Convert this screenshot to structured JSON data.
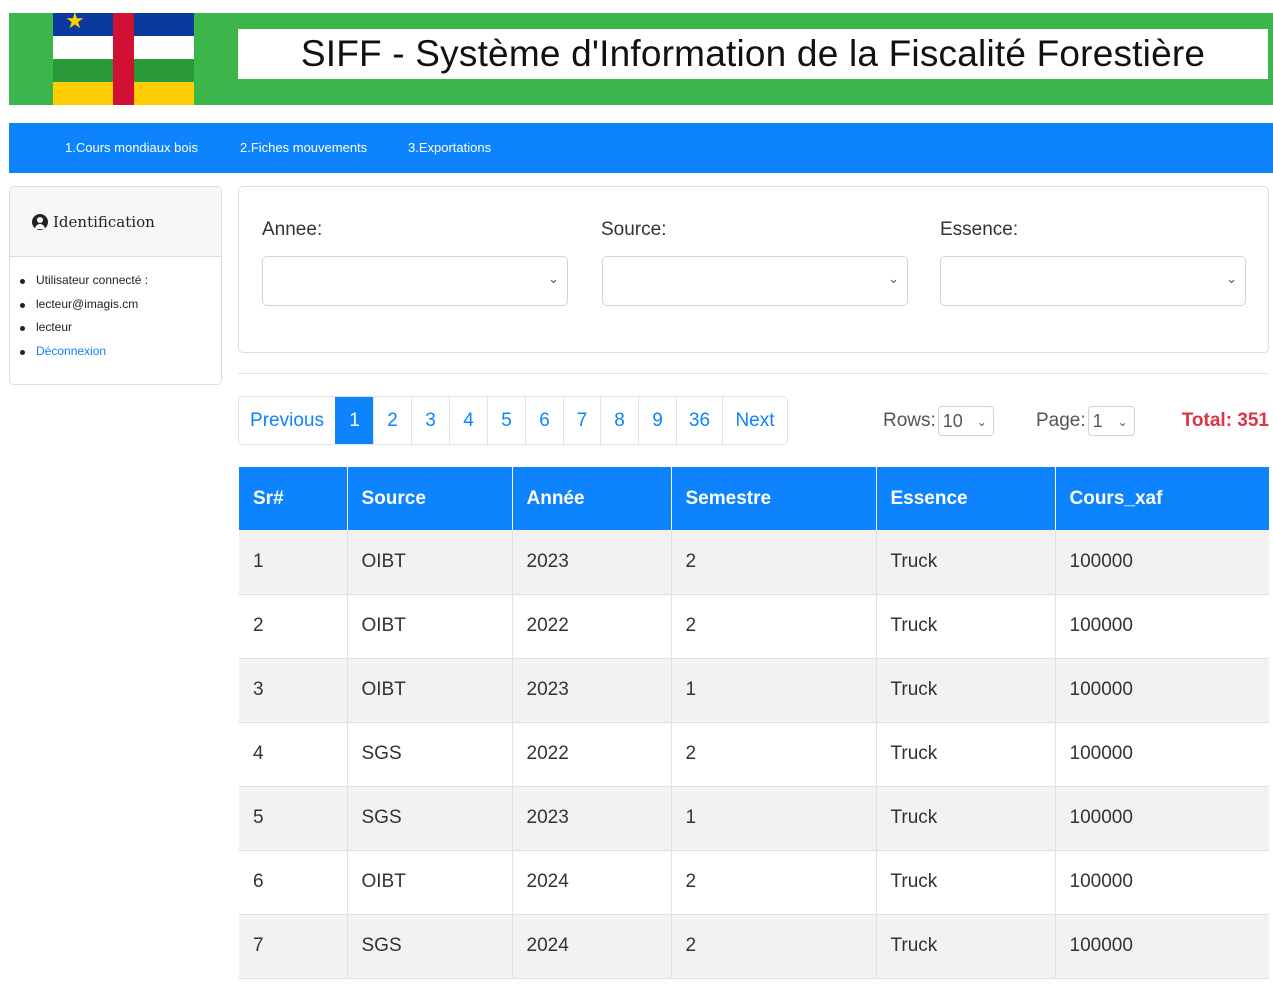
{
  "header": {
    "title": "SIFF - Système d'Information de la Fiscalité Forestière",
    "flag_colors": [
      "#0a3a9e",
      "#ffffff",
      "#2a9a3a",
      "#ffce00",
      "#d21034"
    ]
  },
  "nav": {
    "items": [
      {
        "label": "1.Cours mondiaux bois"
      },
      {
        "label": "2.Fiches mouvements"
      },
      {
        "label": "3.Exportations"
      }
    ]
  },
  "sidebar": {
    "title": "Identification",
    "items": [
      {
        "label": "Utilisateur connecté :"
      },
      {
        "label": "lecteur@imagis.cm"
      },
      {
        "label": "lecteur"
      },
      {
        "label": "Déconnexion"
      }
    ]
  },
  "filters": {
    "annee_label": "Annee:",
    "source_label": "Source:",
    "essence_label": "Essence:",
    "annee_value": "",
    "source_value": "",
    "essence_value": ""
  },
  "pagination": {
    "previous": "Previous",
    "pages": [
      "1",
      "2",
      "3",
      "4",
      "5",
      "6",
      "7",
      "8",
      "9",
      "36"
    ],
    "active_page": "1",
    "next": "Next"
  },
  "controls": {
    "rows_label": "Rows:",
    "rows_value": "10",
    "page_label": "Page:",
    "page_value": "1",
    "total": "Total: 351"
  },
  "table": {
    "headers": [
      "Sr#",
      "Source",
      "Année",
      "Semestre",
      "Essence",
      "Cours_xaf"
    ],
    "rows": [
      [
        "1",
        "OIBT",
        "2023",
        "2",
        "Truck",
        "100000"
      ],
      [
        "2",
        "OIBT",
        "2022",
        "2",
        "Truck",
        "100000"
      ],
      [
        "3",
        "OIBT",
        "2023",
        "1",
        "Truck",
        "100000"
      ],
      [
        "4",
        "SGS",
        "2022",
        "2",
        "Truck",
        "100000"
      ],
      [
        "5",
        "SGS",
        "2023",
        "1",
        "Truck",
        "100000"
      ],
      [
        "6",
        "OIBT",
        "2024",
        "2",
        "Truck",
        "100000"
      ],
      [
        "7",
        "SGS",
        "2024",
        "2",
        "Truck",
        "100000"
      ]
    ]
  },
  "colors": {
    "header_green": "#3cb54a",
    "primary_blue": "#0d83fd",
    "total_red": "#dc3545"
  }
}
